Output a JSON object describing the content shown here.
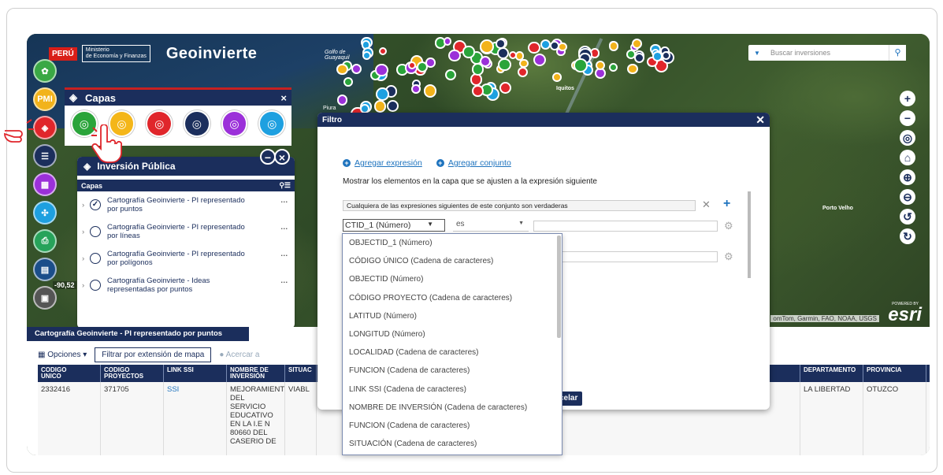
{
  "header": {
    "peru": "PERÚ",
    "ministerio_line1": "Ministerio",
    "ministerio_line2": "de Economía y Finanzas",
    "app_title": "Geoinvierte"
  },
  "map": {
    "labels": {
      "golfo_line1": "Golfo de",
      "golfo_line2": "Guayaquil",
      "iquitos": "Iquitos",
      "piura": "Piura",
      "porto_velho": "Porto Velho"
    },
    "search_placeholder": "Buscar inversiones",
    "attribution": "omTom, Garmin, FAO, NOAA, USGS",
    "esri_powered": "POWERED BY",
    "esri": "esri",
    "coordinate": "-90,52"
  },
  "sidebar": {
    "items": [
      {
        "name": "inversiones-button",
        "color": "#3aa845",
        "glyph": "✿"
      },
      {
        "name": "pmi-button",
        "color": "#f2b31b",
        "glyph": "PMI"
      },
      {
        "name": "capas-button",
        "color": "#e0262b",
        "glyph": "◈"
      },
      {
        "name": "lista-button",
        "color": "#1b2e5c",
        "glyph": "☰"
      },
      {
        "name": "grid-button",
        "color": "#9b30d9",
        "glyph": "▦"
      },
      {
        "name": "herramientas-button",
        "color": "#1ea0e0",
        "glyph": "✣"
      },
      {
        "name": "imprimir-button",
        "color": "#27a35a",
        "glyph": "⎙"
      },
      {
        "name": "documento-button",
        "color": "#1b4e8a",
        "glyph": "▤"
      },
      {
        "name": "reporte-button",
        "color": "#555555",
        "glyph": "▣"
      }
    ]
  },
  "capas_panel": {
    "title": "Capas",
    "close": "×",
    "icons": [
      {
        "color": "#2aa43a"
      },
      {
        "color": "#f4b619"
      },
      {
        "color": "#e0262b"
      },
      {
        "color": "#1b2e5c"
      },
      {
        "color": "#9b30d9"
      },
      {
        "color": "#1ea0e0"
      }
    ]
  },
  "inversion_panel": {
    "title": "Inversión Pública",
    "subheader": "Capas",
    "layers": [
      {
        "line1": "Cartografía Geoinvierte - PI representado",
        "line2": "por puntos",
        "checked": "✓"
      },
      {
        "line1": "Cartografía Geoinvierte - PI representado",
        "line2": "por líneas",
        "checked": ""
      },
      {
        "line1": "Cartografía Geoinvierte - PI representado",
        "line2": "por polígonos",
        "checked": ""
      },
      {
        "line1": "Cartografía Geoinvierte - Ideas",
        "line2": "representadas por puntos",
        "checked": ""
      }
    ]
  },
  "bottom_panel": {
    "tab": "Cartografía Geoinvierte - PI representado por puntos",
    "opciones": "Opciones",
    "filtrar": "Filtrar por extensión de mapa",
    "acercar": "Acercar a",
    "columns": [
      {
        "l1": "CODIGO",
        "l2": "UNICO"
      },
      {
        "l1": "CODIGO",
        "l2": "PROYECTOS"
      },
      {
        "l1": "LINK SSI",
        "l2": ""
      },
      {
        "l1": "NOMBRE DE",
        "l2": "INVERSIÓN"
      },
      {
        "l1": "SITUAC",
        "l2": ""
      },
      {
        "l1": "",
        "l2": ""
      },
      {
        "l1": "",
        "l2": ""
      },
      {
        "l1": "",
        "l2": ""
      },
      {
        "l1": "",
        "l2": ""
      },
      {
        "l1": "",
        "l2": ""
      },
      {
        "l1": "",
        "l2": ""
      },
      {
        "l1": "",
        "l2": ""
      },
      {
        "l1": "DEPARTAMENTO",
        "l2": ""
      },
      {
        "l1": "PROVINCIA",
        "l2": ""
      }
    ],
    "row": {
      "codigo_unico": "2332416",
      "codigo_proyectos": "371705",
      "link": "SSI",
      "nombre_lines": [
        "MEJORAMIENT",
        "DEL",
        "SERVICIO",
        "EDUCATIVO",
        "EN LA I.E N",
        "80660 DEL",
        "CASERIO DE"
      ],
      "situacion": "VIABL",
      "departamento": "LA LIBERTAD",
      "provincia": "OTUZCO"
    }
  },
  "filtro": {
    "title": "Filtro",
    "close": "✕",
    "agregar_expresion": "Agregar expresión",
    "agregar_conjunto": "Agregar conjunto",
    "mostrar": "Mostrar los elementos en la capa que se ajusten a la expresión siguiente",
    "cualquiera": "Cualquiera de las expresiones siguientes de este conjunto son verdaderas",
    "campo": "CTID_1 (Número)",
    "operador": "es",
    "cancelar": "celar"
  },
  "dropdown": {
    "options": [
      "OBJECTID_1 (Número)",
      "CÓDIGO ÚNICO (Cadena de caracteres)",
      "OBJECTID (Número)",
      "CÓDIGO PROYECTO (Cadena de caracteres)",
      "LATITUD (Número)",
      "LONGITUD (Número)",
      "LOCALIDAD (Cadena de caracteres)",
      "FUNCION (Cadena de caracteres)",
      "LINK SSI (Cadena de caracteres)",
      "NOMBRE DE INVERSIÓN (Cadena de caracteres)",
      "FUNCION (Cadena de caracteres)",
      "SITUACIÓN (Cadena de caracteres)"
    ]
  },
  "map_controls": [
    "+",
    "−",
    "◎",
    "⌂",
    "⊕",
    "⊖",
    "↺",
    "↻"
  ]
}
